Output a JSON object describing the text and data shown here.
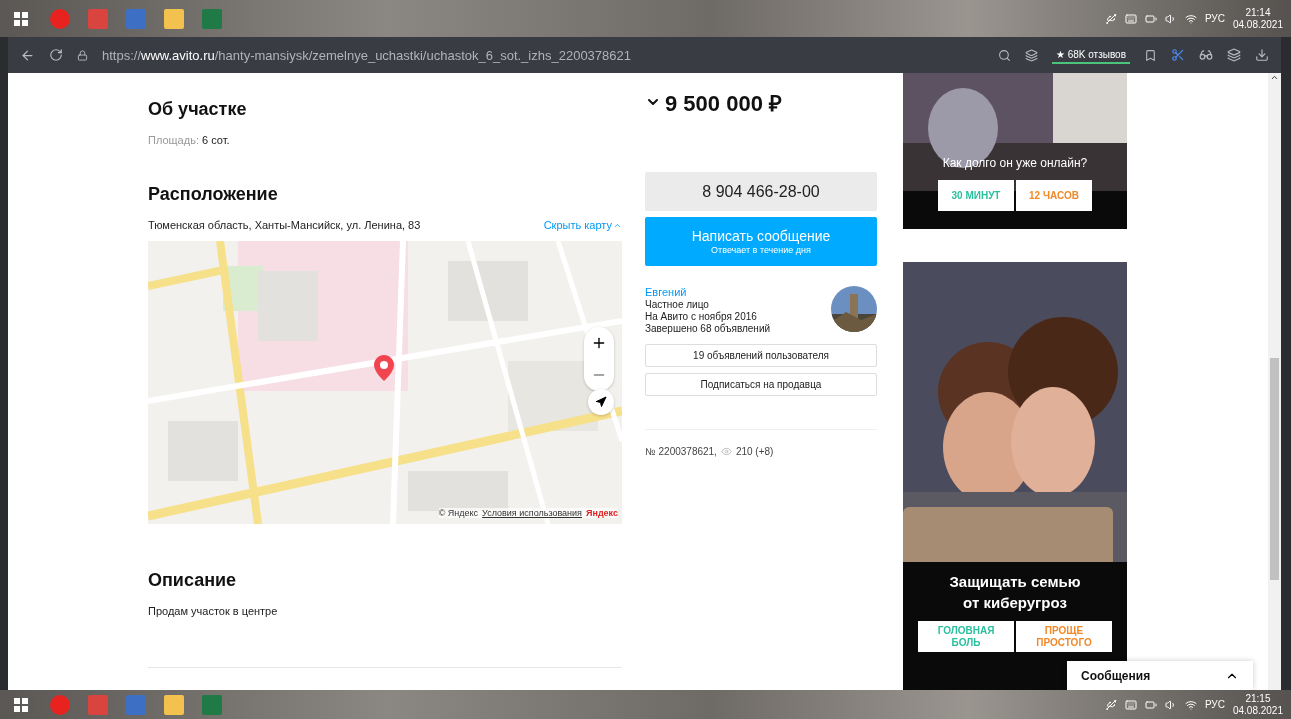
{
  "top_taskbar": {
    "language": "РУС",
    "time": "21:14",
    "date": "04.08.2021"
  },
  "browser": {
    "url": "https://**www.avito.ru**/hanty-mansiysk/zemelnye_uchastki/uchastok_6_sot._izhs_2200378621",
    "reviews": "★ 68K отзывов"
  },
  "about": {
    "title": "Об участке",
    "area_label": "Площадь:",
    "area_value": "6 сот."
  },
  "location": {
    "title": "Расположение",
    "address": "Тюменская область, Ханты-Мансийск, ул. Ленина, 83",
    "toggle": "Скрыть карту",
    "map": {
      "attribution": "© Яндекс",
      "terms": "Условия использования",
      "logo": "Яндекс"
    }
  },
  "description": {
    "title": "Описание",
    "text": "Продам участок в центре"
  },
  "price": "9 500 000 ₽",
  "phone": "8 904 466-28-00",
  "message_button": {
    "label": "Написать сообщение",
    "sublabel": "Отвечает в течение дня"
  },
  "seller": {
    "name": "Евгений",
    "type": "Частное лицо",
    "since": "На Авито с ноября 2016",
    "completed": "Завершено 68 объявлений"
  },
  "seller_buttons": [
    "19 объявлений пользователя",
    "Подписаться на продавца"
  ],
  "listing": {
    "number": "№ 2200378621,",
    "views": "210 (+8)"
  },
  "ads": [
    {
      "kind": "room",
      "headline": "Как долго он уже онлайн?",
      "options": [
        {
          "label": "30 МИНУТ",
          "color": "#2bbf9e"
        },
        {
          "label": "12 ЧАСОВ",
          "color": "#f0892a"
        }
      ]
    },
    {
      "kind": "couple",
      "headline": "Защищать семью\nот киберугроз",
      "options": [
        {
          "label": "ГОЛОВНАЯ\nБОЛЬ",
          "color": "#2bbf9e"
        },
        {
          "label": "ПРОЩЕ\nПРОСТОГО",
          "color": "#f0892a"
        }
      ]
    }
  ],
  "messages_widget": {
    "label": "Сообщения"
  },
  "bottom_taskbar": {
    "language": "РУС",
    "time": "21:15",
    "date": "04.08.2021"
  }
}
